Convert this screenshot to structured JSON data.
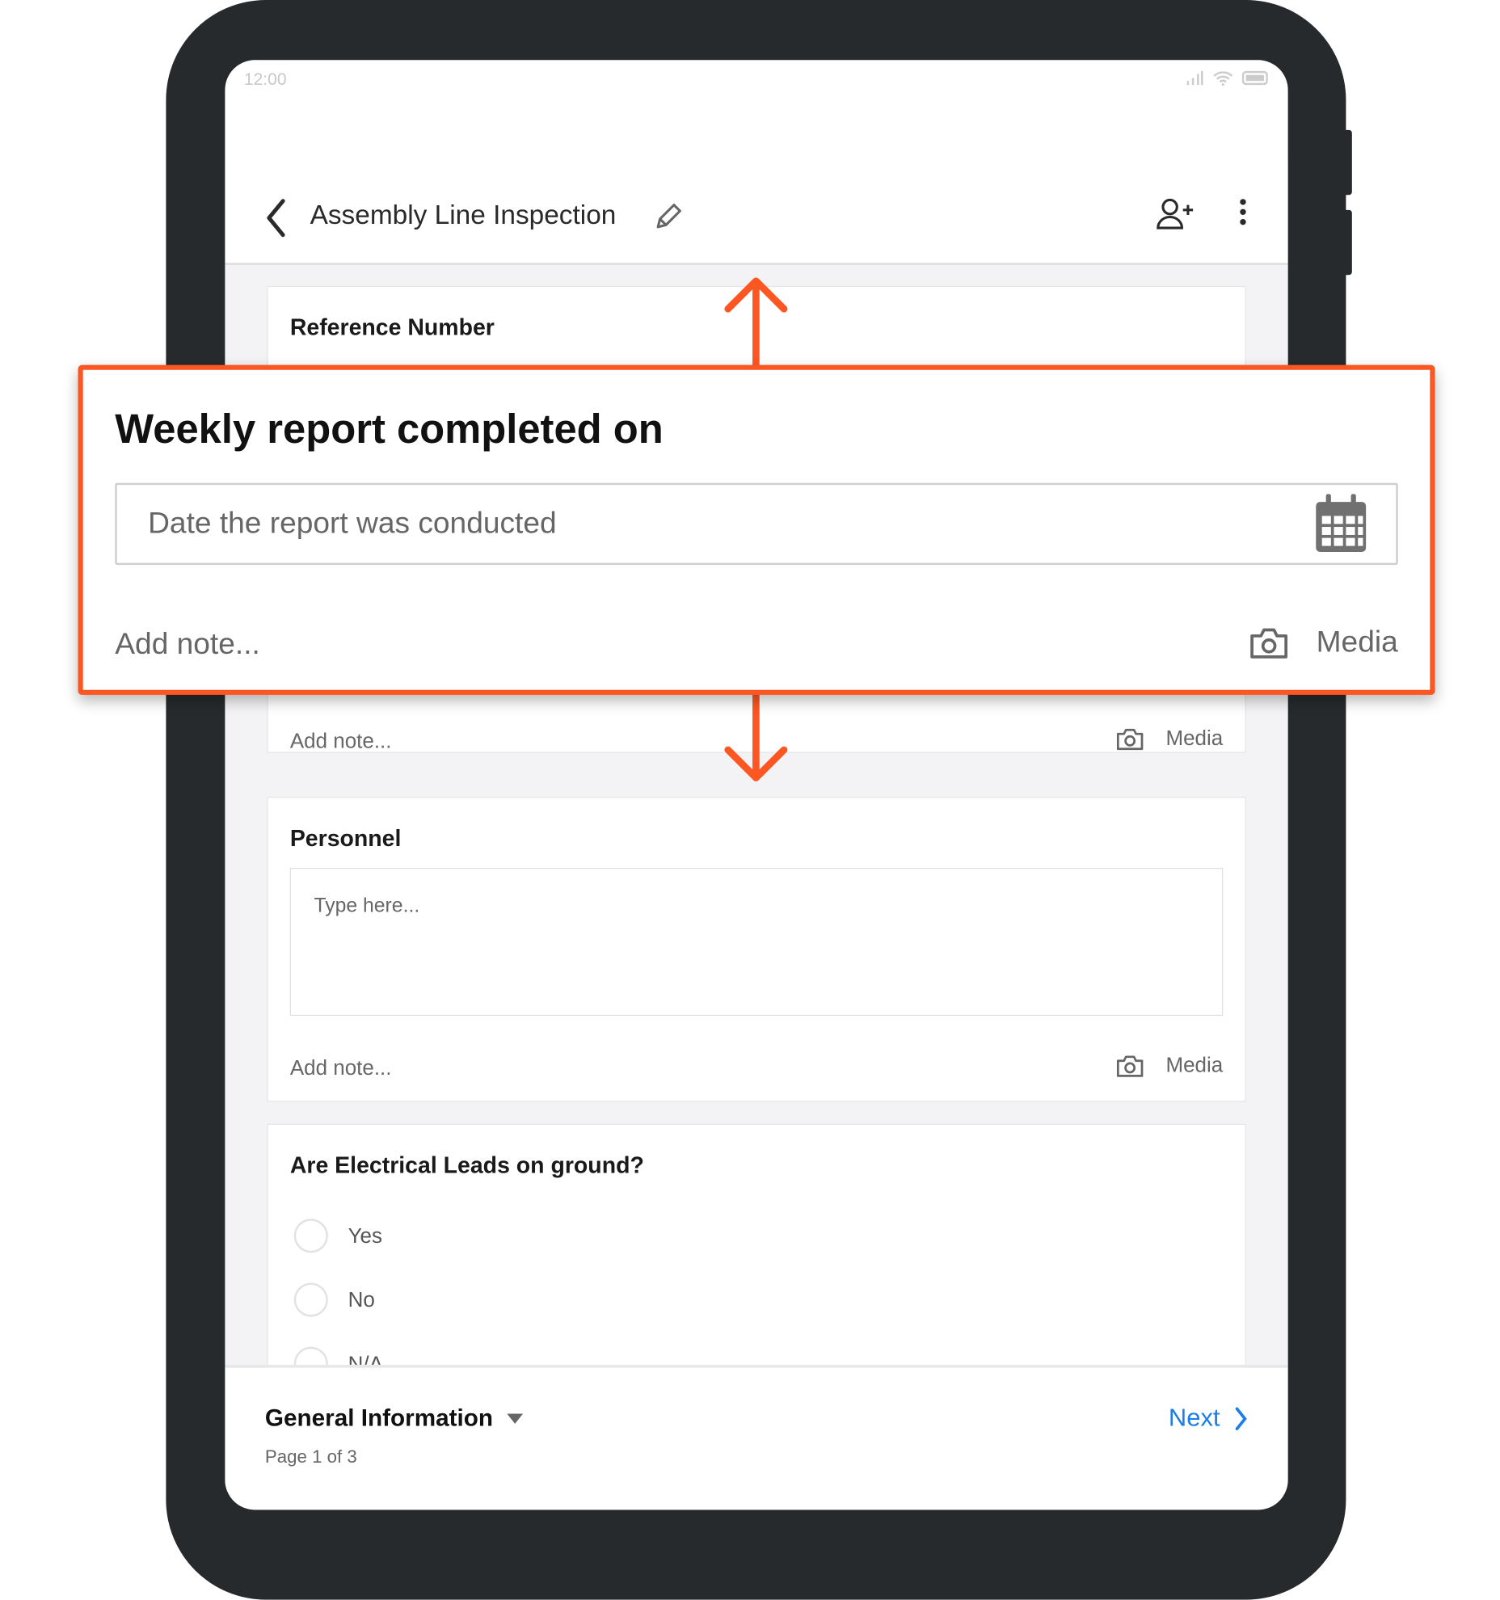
{
  "status_bar": {
    "time": "12:00"
  },
  "header": {
    "title": "Assembly Line Inspection"
  },
  "cards": {
    "reference": {
      "title": "Reference Number"
    },
    "hidden_card": {
      "note": "Add note...",
      "media": "Media"
    },
    "personnel": {
      "title": "Personnel",
      "placeholder": "Type here...",
      "note": "Add note...",
      "media": "Media"
    },
    "electrical": {
      "title": "Are Electrical Leads on ground?",
      "options": [
        "Yes",
        "No",
        "N/A"
      ]
    }
  },
  "footer": {
    "section": "General Information",
    "page": "Page 1 of 3",
    "next": "Next"
  },
  "overlay": {
    "title": "Weekly report completed on",
    "placeholder": "Date the report was conducted",
    "note": "Add note...",
    "media": "Media"
  },
  "colors": {
    "accent": "#fc5622",
    "link": "#1a7fe6",
    "device": "#272a2d"
  }
}
